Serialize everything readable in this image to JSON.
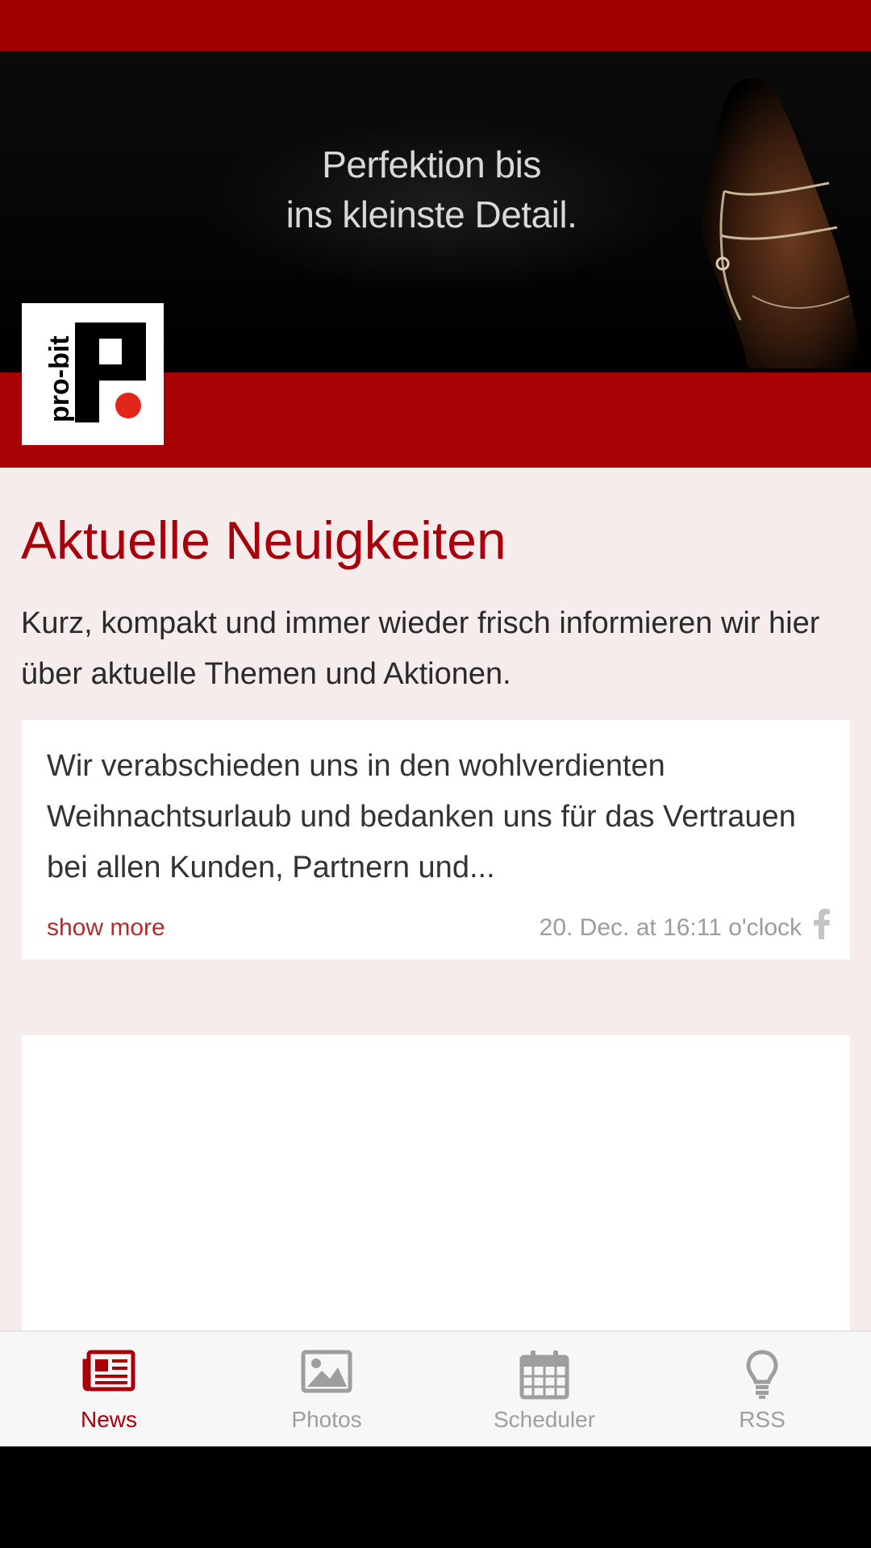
{
  "hero": {
    "tagline_line1": "Perfektion bis",
    "tagline_line2": "ins kleinste Detail."
  },
  "app_bar": {
    "title": "pro-bit",
    "logo_text": "pro-bit",
    "logo_letter": "P",
    "menu_icon": "hamburger-icon"
  },
  "page": {
    "title": "Aktuelle Neuigkeiten",
    "intro": "Kurz, kompakt und immer wieder frisch informieren wir hier über aktuelle Themen und Aktionen."
  },
  "news_items": [
    {
      "text": "Wir verabschieden uns in den wohlverdienten Weihnachtsurlaub und bedanken uns für das Vertrauen bei allen Kunden, Partnern und...",
      "show_more_label": "show more",
      "date": "20. Dec. at 16:11 o'clock",
      "source_icon": "facebook-icon"
    }
  ],
  "bottom_nav": {
    "items": [
      {
        "label": "News",
        "icon": "newspaper-icon",
        "active": true
      },
      {
        "label": "Photos",
        "icon": "image-icon",
        "active": false
      },
      {
        "label": "Scheduler",
        "icon": "calendar-icon",
        "active": false
      },
      {
        "label": "RSS",
        "icon": "lightbulb-icon",
        "active": false
      }
    ]
  },
  "colors": {
    "brand_red": "#a80004",
    "status_bar": "#a00004",
    "title_red": "#a8000a",
    "link_red": "#b52a2a",
    "background": "#f6ecec",
    "nav_inactive": "#9e9e9e"
  }
}
